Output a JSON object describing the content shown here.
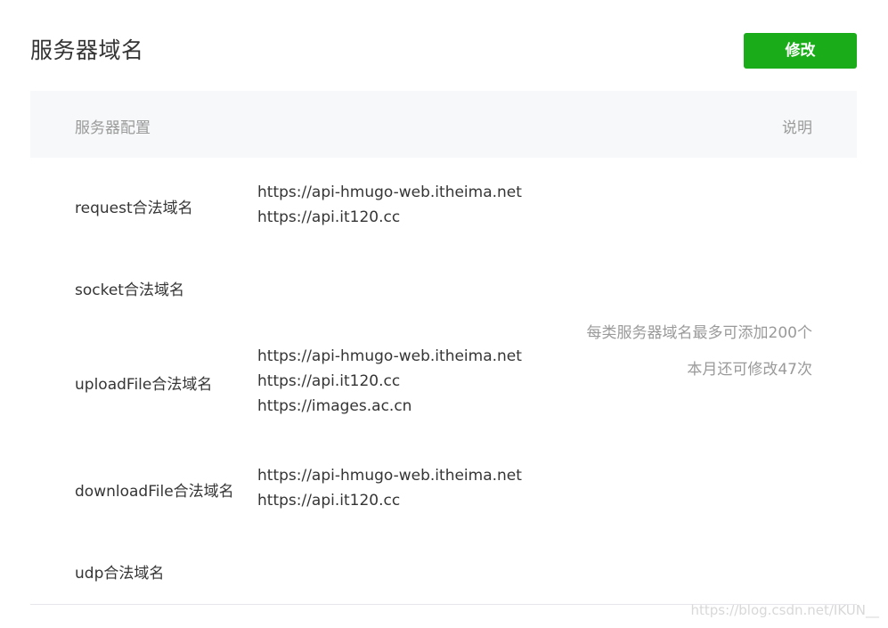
{
  "page": {
    "title": "服务器域名",
    "edit_label": "修改"
  },
  "table": {
    "header": {
      "config": "服务器配置",
      "desc": "说明"
    },
    "rows": [
      {
        "label": "request合法域名",
        "values": [
          "https://api-hmugo-web.itheima.net",
          "https://api.it120.cc"
        ]
      },
      {
        "label": "socket合法域名",
        "values": []
      },
      {
        "label": "uploadFile合法域名",
        "values": [
          "https://api-hmugo-web.itheima.net",
          "https://api.it120.cc",
          "https://images.ac.cn"
        ]
      },
      {
        "label": "downloadFile合法域名",
        "values": [
          "https://api-hmugo-web.itheima.net",
          "https://api.it120.cc"
        ]
      },
      {
        "label": "udp合法域名",
        "values": []
      }
    ],
    "description": {
      "line1": "每类服务器域名最多可添加200个",
      "line2": "本月还可修改47次"
    }
  },
  "watermark": "https://blog.csdn.net/IKUN__",
  "colors": {
    "accent": "#1aad19",
    "header_bg": "#f6f8f9",
    "muted_text": "#9a9a9a"
  }
}
